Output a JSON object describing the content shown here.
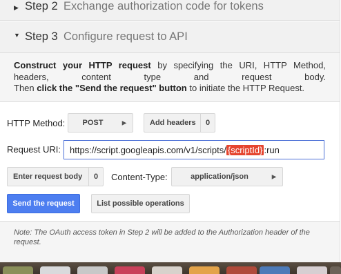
{
  "step2": {
    "number": "Step 2",
    "title": "Exchange authorization code for tokens"
  },
  "step3": {
    "number": "Step 3",
    "title": "Configure request to API"
  },
  "instructions": {
    "bold1": "Construct your HTTP request",
    "text1": "by specifying the URI, HTTP Method, headers, content type and request body.",
    "then": "Then",
    "bold2": "click the \"Send the request\" button",
    "text2": "to initiate the HTTP Request."
  },
  "http_method": {
    "label": "HTTP Method:",
    "value": "POST"
  },
  "add_headers": {
    "label": "Add headers",
    "count": "0"
  },
  "request_uri": {
    "label": "Request URI:",
    "prefix": "https://script.googleapis.com/v1/scripts/",
    "placeholder_token": "{scriptId}",
    "suffix": ":run"
  },
  "request_body": {
    "label": "Enter request body",
    "count": "0"
  },
  "content_type": {
    "label": "Content-Type:",
    "value": "application/json"
  },
  "send_button": "Send the request",
  "list_button": "List possible operations",
  "note": "Note: The OAuth access token in Step 2 will be added to the Authorization header of the request.",
  "colors": {
    "primary": "#4d7ef0",
    "highlight": "#e5452f",
    "input_border": "#4a6fd6"
  },
  "taskbar_icons": [
    "app-icon-1",
    "app-icon-2",
    "app-icon-3",
    "app-icon-4",
    "app-icon-5",
    "app-icon-6",
    "app-icon-7",
    "app-icon-8",
    "app-icon-9",
    "app-icon-10"
  ]
}
